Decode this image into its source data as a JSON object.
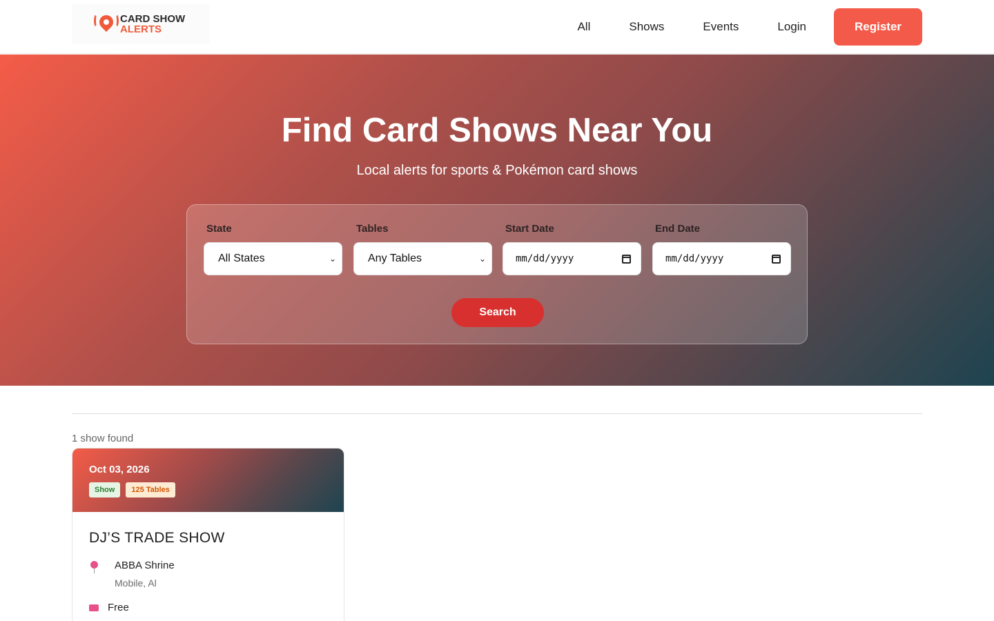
{
  "brand": {
    "line1": "CARD SHOW",
    "line2": "ALERTS"
  },
  "nav": {
    "items": [
      "All",
      "Shows",
      "Events",
      "Login"
    ],
    "register_label": "Register"
  },
  "hero": {
    "title": "Find Card Shows Near You",
    "subtitle": "Local alerts for sports & Pokémon card shows"
  },
  "search": {
    "state": {
      "label": "State",
      "value": "All States"
    },
    "tables": {
      "label": "Tables",
      "value": "Any Tables"
    },
    "start_date": {
      "label": "Start Date",
      "value": "mm/dd/yyyy"
    },
    "end_date": {
      "label": "End Date",
      "value": "mm/dd/yyyy"
    },
    "button_label": "Search"
  },
  "results": {
    "count_text": "1 show found",
    "items": [
      {
        "date": "Oct 03, 2026",
        "type_tag": "Show",
        "tables_tag": "125 Tables",
        "title": "DJ’S TRADE SHOW",
        "venue": "ABBA Shrine",
        "city": "Mobile, Al",
        "price": "Free"
      }
    ]
  },
  "colors": {
    "accent": "#f45a49",
    "search_button": "#d8302e",
    "hero_start": "#f45c48",
    "hero_end": "#1d4450"
  },
  "icons": [
    "logo-icon",
    "chevron-down-icon",
    "calendar-icon",
    "location-pin-icon",
    "ticket-icon"
  ]
}
